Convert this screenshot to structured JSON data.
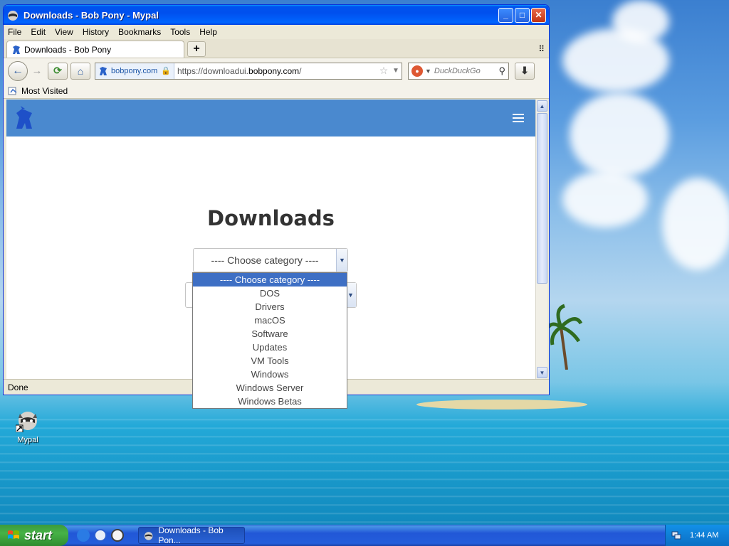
{
  "window": {
    "title": "Downloads - Bob Pony - Mypal",
    "minimize": "_",
    "maximize": "□",
    "close": "✕"
  },
  "menu": [
    "File",
    "Edit",
    "View",
    "History",
    "Bookmarks",
    "Tools",
    "Help"
  ],
  "tab": {
    "title": "Downloads - Bob Pony",
    "new_tab": "+"
  },
  "url": {
    "identity": "bobpony.com",
    "prefix": "https://downloadui.",
    "domain": "bobpony.com",
    "path": "/"
  },
  "search": {
    "placeholder": "DuckDuckGo"
  },
  "bookmarks": {
    "most_visited": "Most Visited"
  },
  "page": {
    "heading": "Downloads",
    "category_selected": "---- Choose category ----",
    "category_options": [
      "---- Choose category ----",
      "DOS",
      "Drivers",
      "macOS",
      "Software",
      "Updates",
      "VM Tools",
      "Windows",
      "Windows Server",
      "Windows Betas"
    ]
  },
  "status": "Done",
  "desktop": {
    "icon_label": "Mypal"
  },
  "taskbar": {
    "start": "start",
    "task": "Downloads - Bob Pon...",
    "clock": "1:44 AM"
  },
  "colors": {
    "site_nav": "#4a89cf",
    "selected_option": "#3e6fc4",
    "title_bar": "#0053ee"
  }
}
